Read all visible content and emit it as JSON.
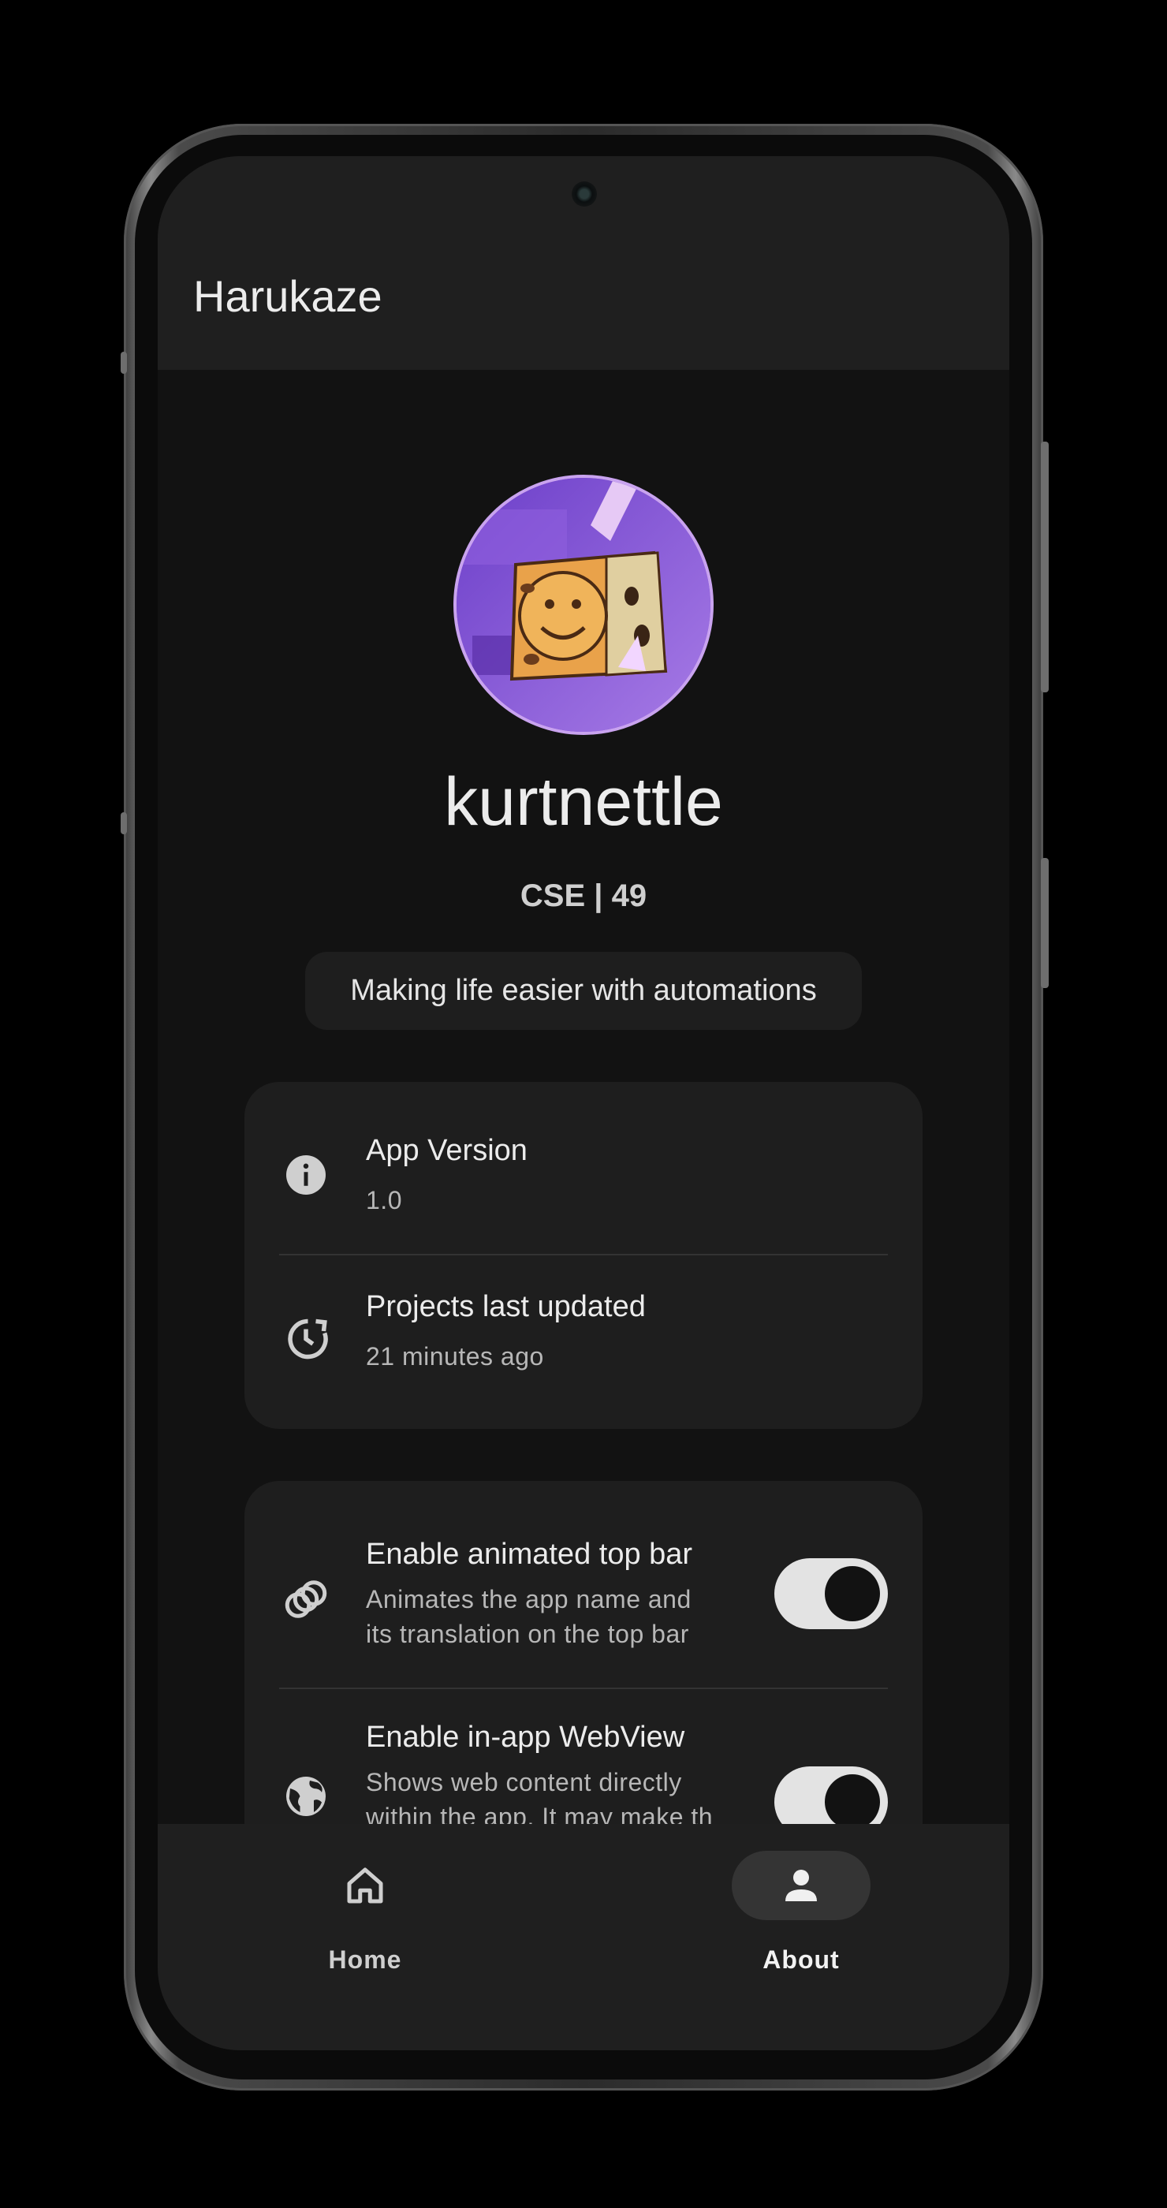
{
  "app": {
    "title": "Harukaze"
  },
  "profile": {
    "username": "kurtnettle",
    "subtitle": "CSE | 49",
    "bio": "Making life easier with automations",
    "avatar_description": "spongebob-avatar"
  },
  "info_card": {
    "items": [
      {
        "icon": "info-icon",
        "title": "App Version",
        "value": "1.0"
      },
      {
        "icon": "history-icon",
        "title": "Projects last updated",
        "value": "21 minutes ago"
      }
    ]
  },
  "settings_card": {
    "items": [
      {
        "icon": "rings-icon",
        "title": "Enable animated top bar",
        "desc_line1": "Animates the app name and",
        "desc_line2": "its translation on the top bar",
        "enabled": true
      },
      {
        "icon": "globe-icon",
        "title": "Enable in-app WebView",
        "desc_line1": "Shows web content directly",
        "desc_line2": "within the app. It may make th",
        "enabled": true
      }
    ]
  },
  "bottom_nav": {
    "items": [
      {
        "icon": "home-icon",
        "label": "Home",
        "active": false
      },
      {
        "icon": "person-icon",
        "label": "About",
        "active": true
      }
    ]
  },
  "colors": {
    "background": "#121212",
    "surface": "#1e1e1e",
    "avatar_border": "#c9a3ef",
    "toggle_on_track": "#e3e3e3"
  }
}
